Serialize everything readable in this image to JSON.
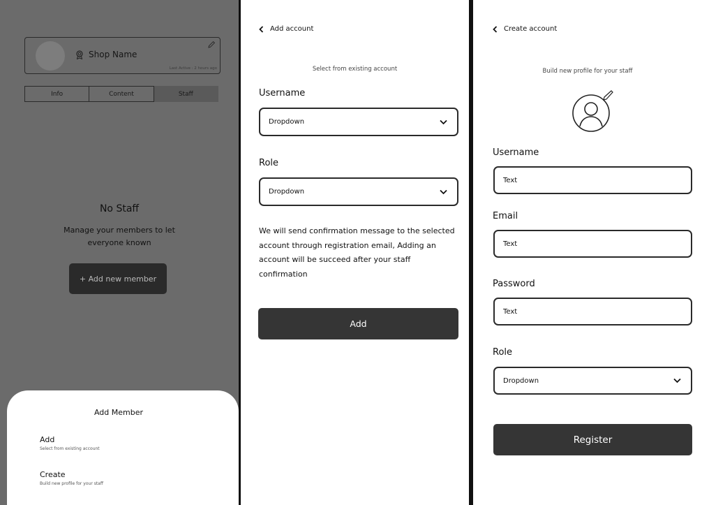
{
  "screen1": {
    "profile": {
      "shop_name": "Shop Name",
      "last_active": "Last Active : 2 hours ago"
    },
    "tabs": [
      {
        "label": "Info",
        "active": false
      },
      {
        "label": "Content",
        "active": false
      },
      {
        "label": "Staff",
        "active": true
      }
    ],
    "empty_state": {
      "title": "No Staff",
      "description": "Manage your members to let everyone known",
      "button_label": "+ Add new member"
    },
    "sheet": {
      "title": "Add Member",
      "items": [
        {
          "title": "Add",
          "subtitle": "Select from existing account"
        },
        {
          "title": "Create",
          "subtitle": "Build new profile for your staff"
        }
      ]
    }
  },
  "screen2": {
    "back_label": "Add account",
    "subtitle": "Select from existing account",
    "username_label": "Username",
    "username_value": "Dropdown",
    "role_label": "Role",
    "role_value": "Dropdown",
    "note": "We will send confirmation message to the selected account through registration email, Adding an account will be succeed after your staff confirmation",
    "button_label": "Add"
  },
  "screen3": {
    "back_label": "Create account",
    "subtitle": "Build new profile for your staff",
    "username_label": "Username",
    "username_value": "Text",
    "email_label": "Email",
    "email_value": "Text",
    "password_label": "Password",
    "password_value": "Text",
    "role_label": "Role",
    "role_value": "Dropdown",
    "button_label": "Register"
  },
  "icons": {
    "back": "chevron-left-icon",
    "dropdown": "chevron-down-icon",
    "edit": "pencil-icon",
    "badge": "award-icon",
    "avatar_edit": "user-circle-edit-icon"
  },
  "colors": {
    "overlay_bg": "#6b6b6b",
    "button_dark": "#353535",
    "sheet_bg": "#ffffff"
  }
}
